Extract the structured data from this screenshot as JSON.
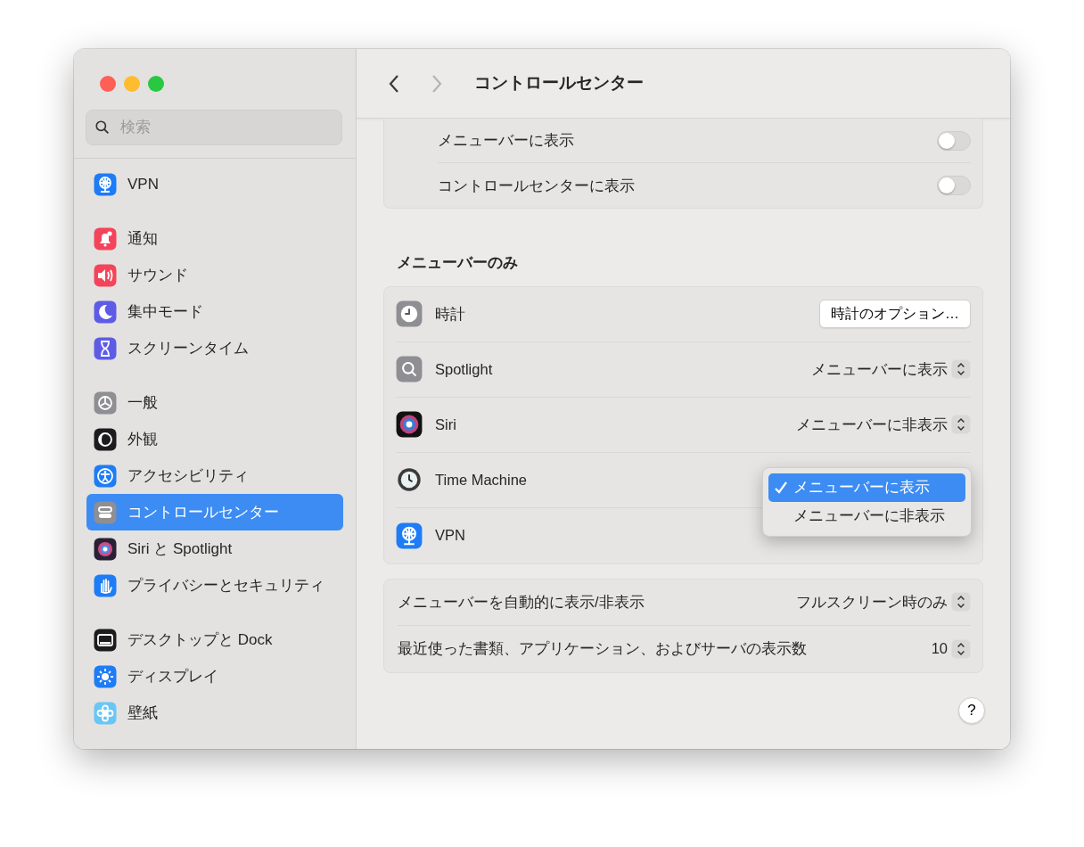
{
  "window": {
    "title": "コントロールセンター"
  },
  "search": {
    "placeholder": "検索"
  },
  "sidebar": {
    "groups": [
      [
        {
          "label": "VPN",
          "selected": false
        }
      ],
      [
        {
          "label": "通知",
          "selected": false
        },
        {
          "label": "サウンド",
          "selected": false
        },
        {
          "label": "集中モード",
          "selected": false
        },
        {
          "label": "スクリーンタイム",
          "selected": false
        }
      ],
      [
        {
          "label": "一般",
          "selected": false
        },
        {
          "label": "外観",
          "selected": false
        },
        {
          "label": "アクセシビリティ",
          "selected": false
        },
        {
          "label": "コントロールセンター",
          "selected": true
        },
        {
          "label": "Siri と Spotlight",
          "selected": false
        },
        {
          "label": "プライバシーとセキュリティ",
          "selected": false
        }
      ],
      [
        {
          "label": "デスクトップと Dock",
          "selected": false
        },
        {
          "label": "ディスプレイ",
          "selected": false
        },
        {
          "label": "壁紙",
          "selected": false
        }
      ]
    ]
  },
  "toggle_rows": [
    {
      "label": "メニューバーに表示",
      "on": false
    },
    {
      "label": "コントロールセンターに表示",
      "on": false
    }
  ],
  "menu_bar_only": {
    "heading": "メニューバーのみ",
    "rows": [
      {
        "kind": "button",
        "label": "時計",
        "value": "時計のオプション…"
      },
      {
        "kind": "select",
        "label": "Spotlight",
        "value": "メニューバーに表示"
      },
      {
        "kind": "select",
        "label": "Siri",
        "value": "メニューバーに非表示"
      },
      {
        "kind": "select",
        "label": "Time Machine"
      },
      {
        "kind": "select",
        "label": "VPN"
      }
    ]
  },
  "popup_menu": {
    "items": [
      {
        "label": "メニューバーに表示",
        "selected": true
      },
      {
        "label": "メニューバーに非表示",
        "selected": false
      }
    ]
  },
  "other_rows": [
    {
      "kind": "select",
      "label": "メニューバーを自動的に表示/非表示",
      "value": "フルスクリーン時のみ"
    },
    {
      "kind": "select",
      "label": "最近使った書類、アプリケーション、およびサーバの表示数",
      "value": "10"
    }
  ],
  "help": {
    "label": "?"
  }
}
